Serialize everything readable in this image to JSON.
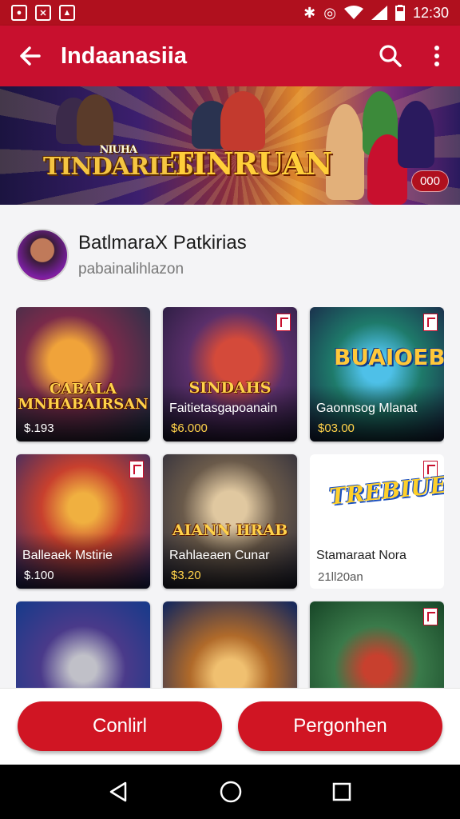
{
  "status_bar": {
    "time": "12:30",
    "icons": [
      "notification-icon-1",
      "notification-icon-2",
      "notification-icon-3",
      "bluetooth-icon",
      "vibrate-icon",
      "wifi-icon",
      "signal-icon",
      "battery-icon"
    ]
  },
  "app_bar": {
    "title": "Indaanasiia",
    "back_icon": "arrow-left-icon",
    "search_icon": "search-icon",
    "more_icon": "more-vert-icon"
  },
  "banner": {
    "logo_left_small": "NIUHA",
    "logo_left": "TINDARIES",
    "logo_center": "TINRUAN",
    "badge": "000"
  },
  "profile": {
    "name": "BatlmaraX Patkirias",
    "subtitle": "pabainalihlazon"
  },
  "games": [
    {
      "logo": "CABALA MNHABAIRSAN",
      "title": "",
      "price": "$.193"
    },
    {
      "logo": "SINDAHS",
      "title": "Faitietasgapoanain",
      "price": "$6.000"
    },
    {
      "logo": "BUAIOEB",
      "title": "Gaonnsog Mlanat",
      "price": "$03.00"
    },
    {
      "logo": "",
      "title": "Balleaek Mstirie",
      "price": "$.100"
    },
    {
      "logo": "AIANN HRAB",
      "title": "Rahlaeaen Cunar",
      "price": "$3.20"
    },
    {
      "logo": "TREBIUEP",
      "title": "Stamaraat Nora",
      "price": "21ll20an"
    },
    {
      "logo": "",
      "title": "",
      "price": ""
    },
    {
      "logo": "",
      "title": "",
      "price": ""
    },
    {
      "logo": "",
      "title": "",
      "price": ""
    }
  ],
  "buttons": {
    "left": "Conlirl",
    "right": "Pergonhen"
  },
  "colors": {
    "primary": "#c8102e",
    "status_bar": "#b0101e",
    "button": "#d01523"
  }
}
